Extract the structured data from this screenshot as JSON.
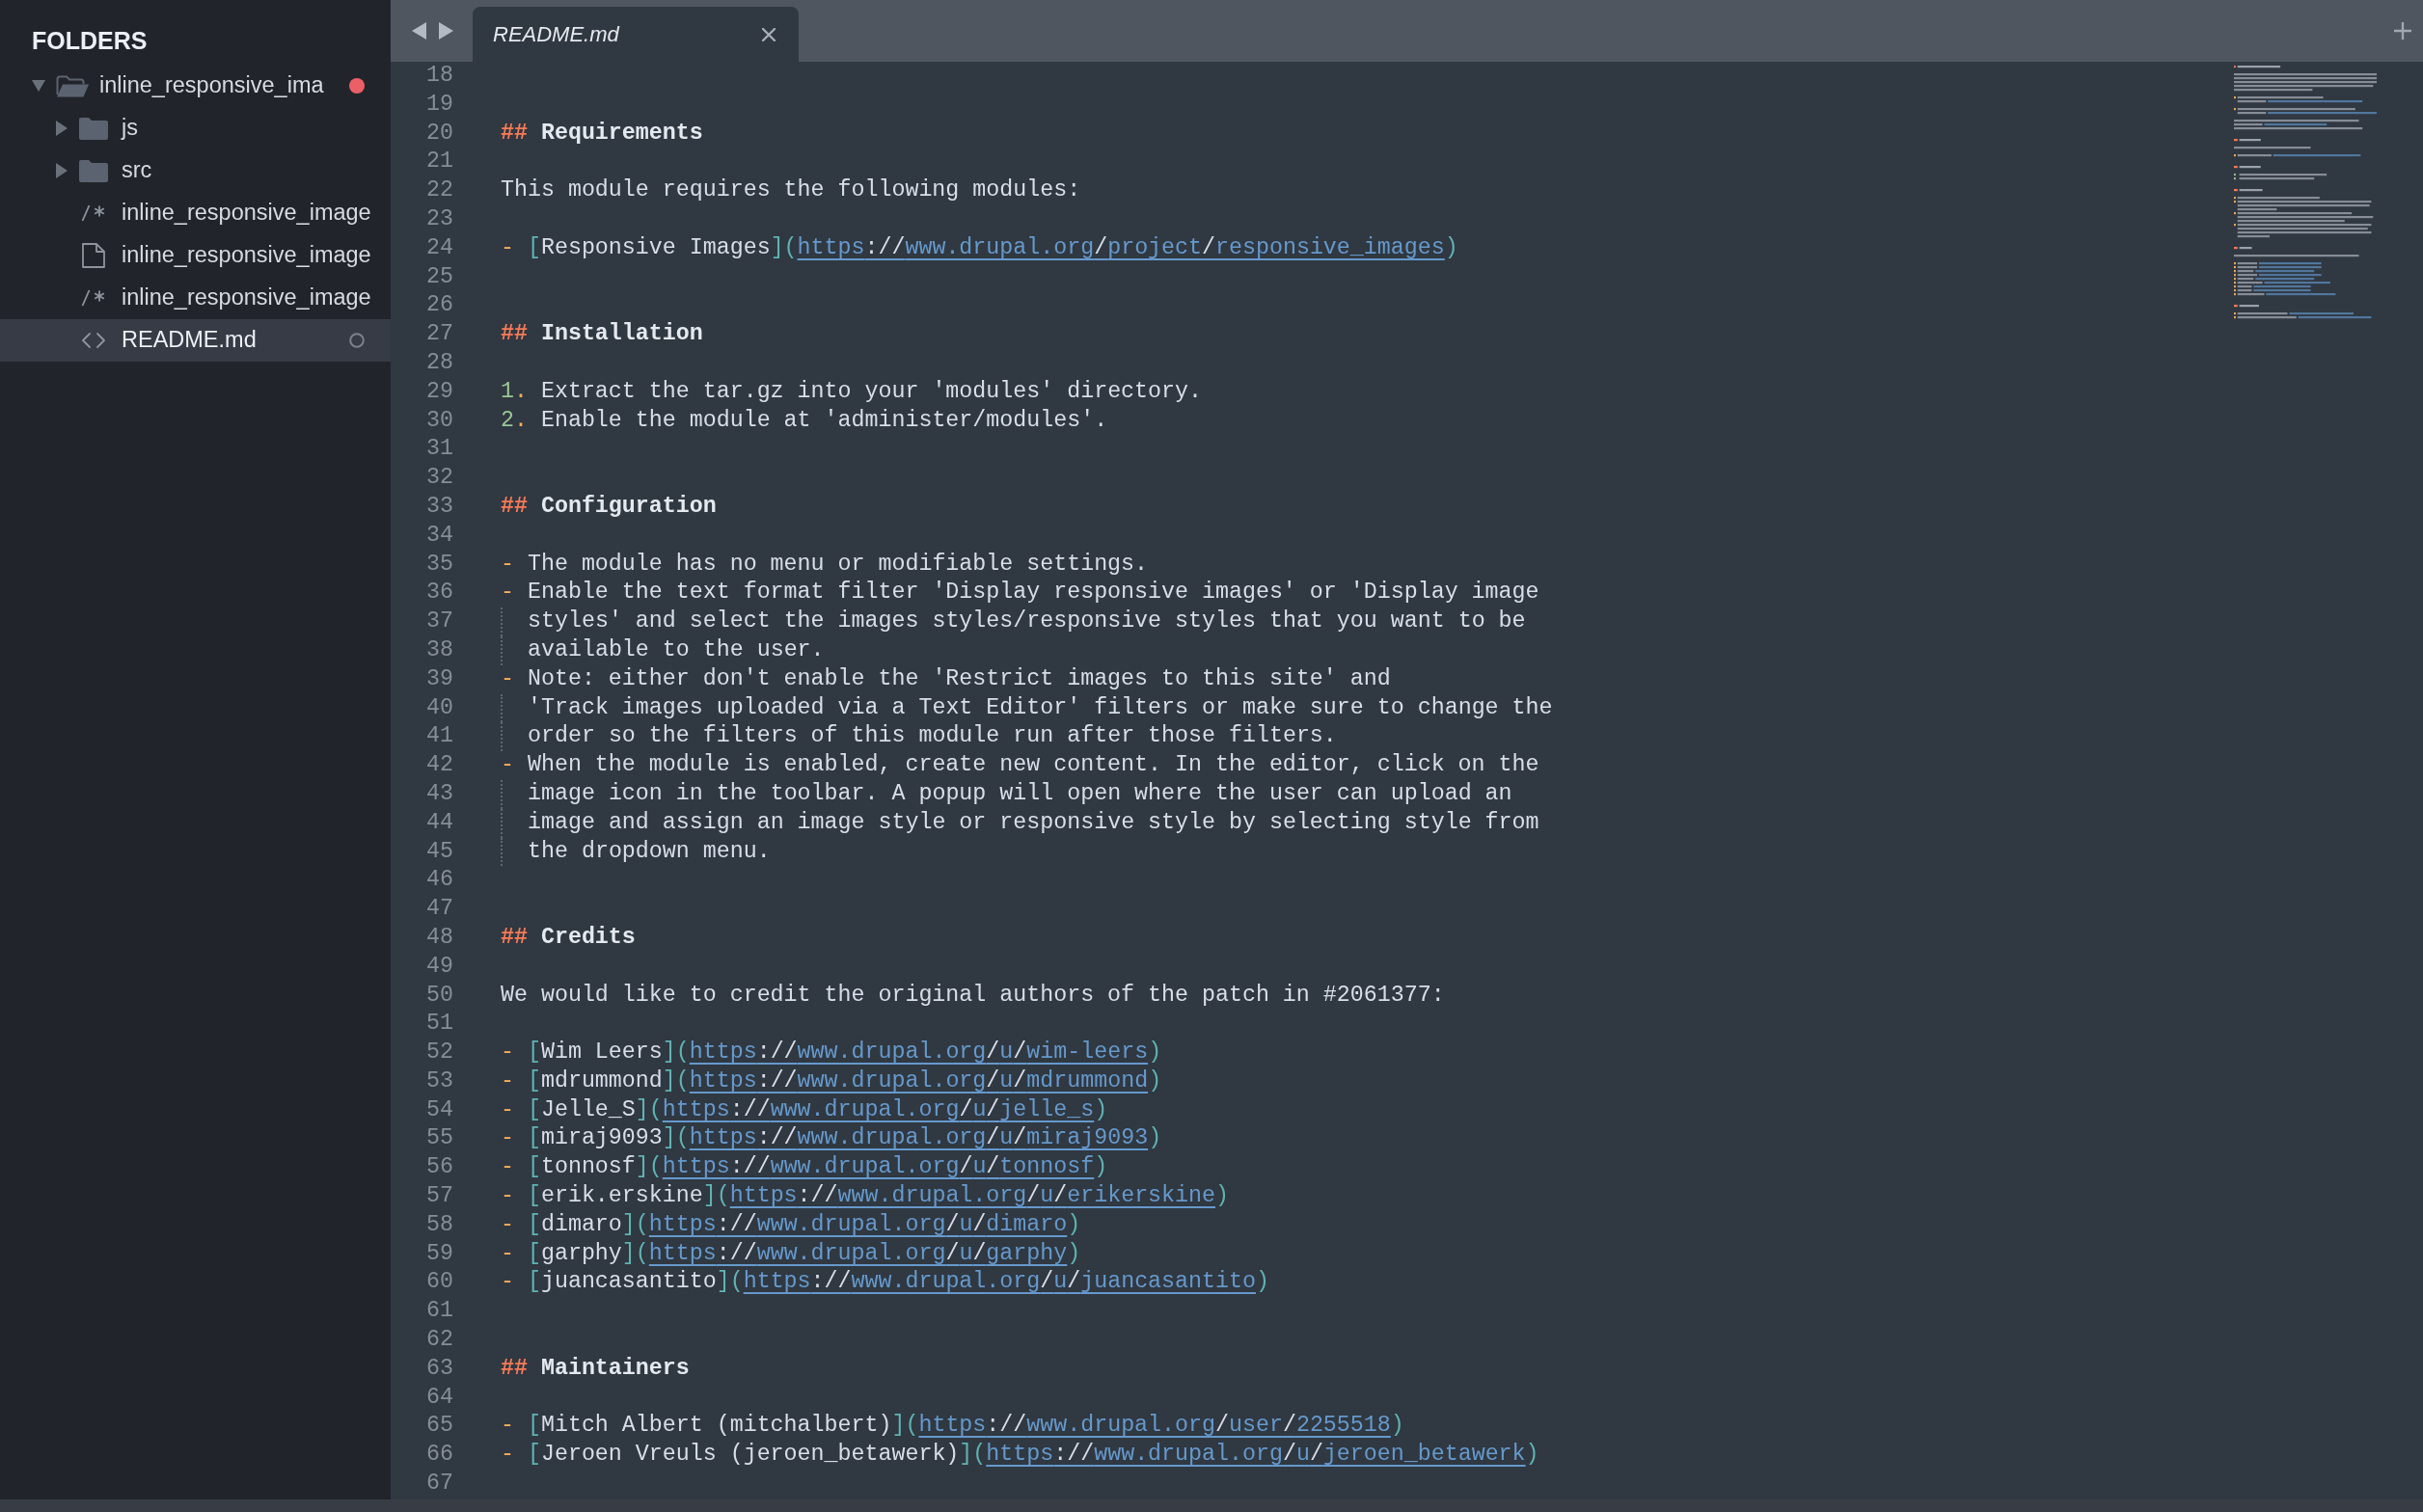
{
  "sidebar": {
    "title": "FOLDERS",
    "items": [
      {
        "kind": "folder",
        "name": "inline_responsive_ima",
        "expanded": true,
        "selected": false,
        "modified": true,
        "open": false,
        "children": [
          {
            "kind": "folder",
            "name": "js",
            "expanded": false,
            "selected": false,
            "modified": false,
            "open": false
          },
          {
            "kind": "folder",
            "name": "src",
            "expanded": false,
            "selected": false,
            "modified": false,
            "open": false
          },
          {
            "kind": "comment_file",
            "name": "inline_responsive_image",
            "selected": false,
            "modified": false,
            "open": false
          },
          {
            "kind": "plain_file",
            "name": "inline_responsive_image",
            "selected": false,
            "modified": false,
            "open": false
          },
          {
            "kind": "comment_file",
            "name": "inline_responsive_image",
            "selected": false,
            "modified": false,
            "open": false
          },
          {
            "kind": "markup_file",
            "name": "README.md",
            "selected": true,
            "modified": false,
            "open": true
          }
        ]
      }
    ]
  },
  "tabs": [
    {
      "title": "README.md",
      "selected": true
    }
  ],
  "editor": {
    "lines": [
      {
        "number": "18",
        "kind": "blank"
      },
      {
        "number": "19",
        "kind": "blank"
      },
      {
        "number": "20",
        "kind": "heading",
        "text": "## Requirements"
      },
      {
        "number": "21",
        "kind": "blank"
      },
      {
        "number": "22",
        "kind": "text",
        "text": "This module requires the following modules:"
      },
      {
        "number": "23",
        "kind": "blank"
      },
      {
        "number": "24",
        "kind": "link",
        "text": "- [Responsive Images](https://www.drupal.org/project/responsive_images)"
      },
      {
        "number": "25",
        "kind": "blank"
      },
      {
        "number": "26",
        "kind": "blank"
      },
      {
        "number": "27",
        "kind": "heading",
        "text": "## Installation"
      },
      {
        "number": "28",
        "kind": "blank"
      },
      {
        "number": "29",
        "kind": "numbered",
        "text": "1. Extract the tar.gz into your 'modules' directory."
      },
      {
        "number": "30",
        "kind": "numbered",
        "text": "2. Enable the module at 'administer/modules'."
      },
      {
        "number": "31",
        "kind": "blank"
      },
      {
        "number": "32",
        "kind": "blank"
      },
      {
        "number": "33",
        "kind": "heading",
        "text": "## Configuration"
      },
      {
        "number": "34",
        "kind": "blank"
      },
      {
        "number": "35",
        "kind": "bullet",
        "text": "- The module has no menu or modifiable settings."
      },
      {
        "number": "36",
        "kind": "bullet",
        "text": "- Enable the text format filter 'Display responsive images' or 'Display image"
      },
      {
        "number": "37",
        "kind": "continuation",
        "text": "styles' and select the images styles/responsive styles that you want to be"
      },
      {
        "number": "38",
        "kind": "continuation",
        "text": "available to the user."
      },
      {
        "number": "39",
        "kind": "bullet",
        "text": "- Note: either don't enable the 'Restrict images to this site' and"
      },
      {
        "number": "40",
        "kind": "continuation",
        "text": "'Track images uploaded via a Text Editor' filters or make sure to change the"
      },
      {
        "number": "41",
        "kind": "continuation",
        "text": "order so the filters of this module run after those filters."
      },
      {
        "number": "42",
        "kind": "bullet",
        "text": "- When the module is enabled, create new content. In the editor, click on the"
      },
      {
        "number": "43",
        "kind": "continuation",
        "text": "image icon in the toolbar. A popup will open where the user can upload an"
      },
      {
        "number": "44",
        "kind": "continuation",
        "text": "image and assign an image style or responsive style by selecting style from"
      },
      {
        "number": "45",
        "kind": "continuation",
        "text": "the dropdown menu."
      },
      {
        "number": "46",
        "kind": "blank"
      },
      {
        "number": "47",
        "kind": "blank"
      },
      {
        "number": "48",
        "kind": "heading",
        "text": "## Credits"
      },
      {
        "number": "49",
        "kind": "blank"
      },
      {
        "number": "50",
        "kind": "text",
        "text": "We would like to credit the original authors of the patch in #2061377:"
      },
      {
        "number": "51",
        "kind": "blank"
      },
      {
        "number": "52",
        "kind": "link",
        "text": "- [Wim Leers](https://www.drupal.org/u/wim-leers)"
      },
      {
        "number": "53",
        "kind": "link",
        "text": "- [mdrummond](https://www.drupal.org/u/mdrummond)"
      },
      {
        "number": "54",
        "kind": "link",
        "text": "- [Jelle_S](https://www.drupal.org/u/jelle_s)"
      },
      {
        "number": "55",
        "kind": "link",
        "text": "- [miraj9093](https://www.drupal.org/u/miraj9093)"
      },
      {
        "number": "56",
        "kind": "link",
        "text": "- [tonnosf](https://www.drupal.org/u/tonnosf)"
      },
      {
        "number": "57",
        "kind": "link",
        "text": "- [erik.erskine](https://www.drupal.org/u/erikerskine)"
      },
      {
        "number": "58",
        "kind": "link",
        "text": "- [dimaro](https://www.drupal.org/u/dimaro)"
      },
      {
        "number": "59",
        "kind": "link",
        "text": "- [garphy](https://www.drupal.org/u/garphy)"
      },
      {
        "number": "60",
        "kind": "link",
        "text": "- [juancasantito](https://www.drupal.org/u/juancasantito)"
      },
      {
        "number": "61",
        "kind": "blank"
      },
      {
        "number": "62",
        "kind": "blank"
      },
      {
        "number": "63",
        "kind": "heading",
        "text": "## Maintainers"
      },
      {
        "number": "64",
        "kind": "blank"
      },
      {
        "number": "65",
        "kind": "link",
        "text": "- [Mitch Albert (mitchalbert)](https://www.drupal.org/user/2255518)"
      },
      {
        "number": "66",
        "kind": "link",
        "text": "- [Jeroen Vreuls (jeroen_betawerk)](https://www.drupal.org/u/jeroen_betawerk)"
      },
      {
        "number": "67",
        "kind": "blank"
      }
    ]
  }
}
